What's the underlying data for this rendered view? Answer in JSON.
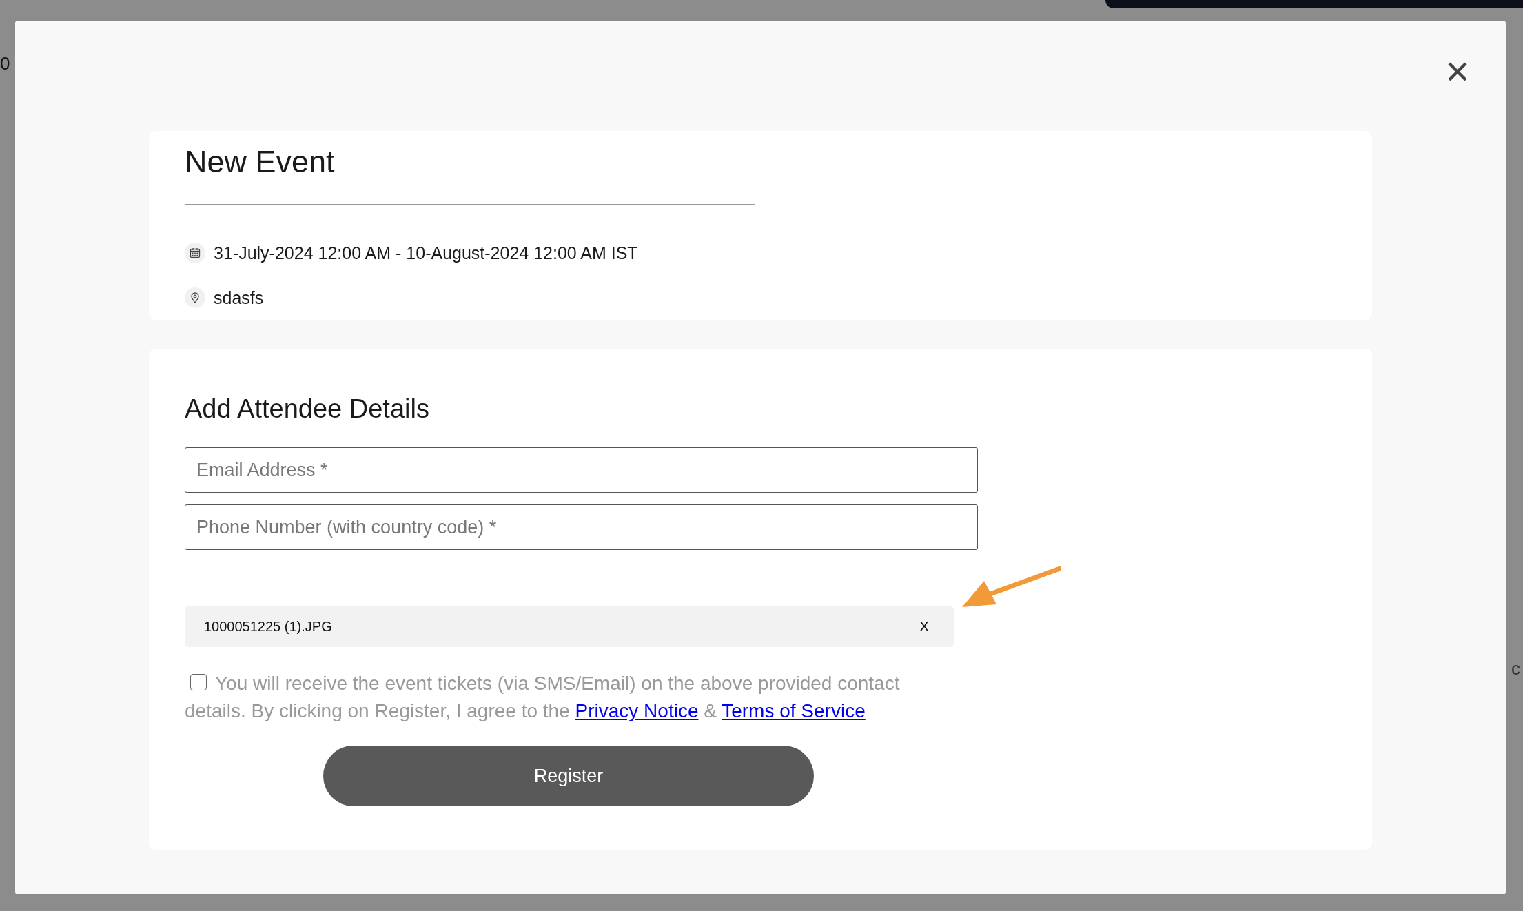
{
  "background": {
    "left_fragment": "0",
    "right_fragment": "c"
  },
  "event": {
    "title": "New Event",
    "date_range": "31-July-2024 12:00 AM - 10-August-2024 12:00 AM IST",
    "location": "sdasfs"
  },
  "attendee_form": {
    "heading": "Add Attendee Details",
    "fields": [
      {
        "placeholder": "Email Address *"
      },
      {
        "placeholder": "Phone Number (with country code) *"
      }
    ],
    "attachment": {
      "file_name": "1000051225 (1).JPG",
      "remove_label": "X"
    },
    "consent": {
      "checked": false,
      "text": "You will receive the event tickets (via SMS/Email) on the above provided contact details. By clicking on Register, I agree to the",
      "privacy_link": "Privacy Notice",
      "separator": "&",
      "terms_link": "Terms of Service"
    },
    "submit_label": "Register"
  }
}
